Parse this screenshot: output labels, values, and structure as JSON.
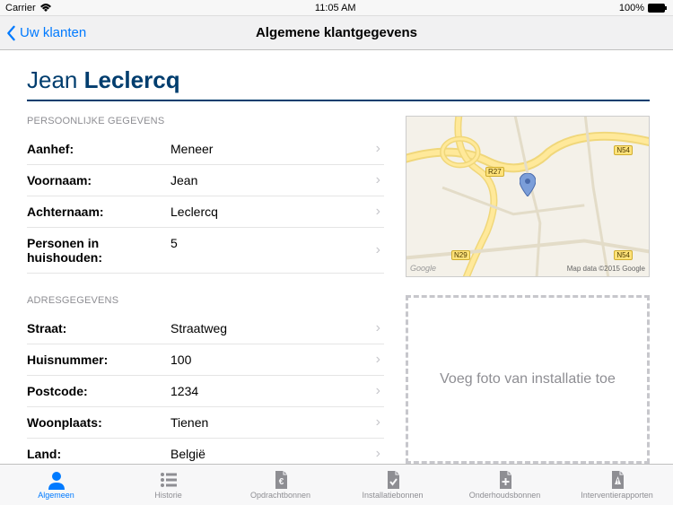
{
  "status": {
    "carrier": "Carrier",
    "time": "11:05 AM",
    "battery": "100%"
  },
  "nav": {
    "back_label": "Uw klanten",
    "title": "Algemene klantgegevens"
  },
  "customer": {
    "first": "Jean",
    "last": "Leclercq"
  },
  "sections": {
    "personal_header": "PERSOONLIJKE GEGEVENS",
    "address_header": "ADRESGEGEVENS"
  },
  "rows": {
    "aanhef": {
      "label": "Aanhef:",
      "value": "Meneer"
    },
    "voornaam": {
      "label": "Voornaam:",
      "value": "Jean"
    },
    "achternaam": {
      "label": "Achternaam:",
      "value": " Leclercq"
    },
    "personen": {
      "label": "Personen in huishouden:",
      "value": "5"
    },
    "straat": {
      "label": "Straat:",
      "value": "Straatweg"
    },
    "huisnummer": {
      "label": "Huisnummer:",
      "value": "100"
    },
    "postcode": {
      "label": "Postcode:",
      "value": "1234"
    },
    "woonplaats": {
      "label": "Woonplaats:",
      "value": "Tienen"
    },
    "land": {
      "label": "Land:",
      "value": "België"
    }
  },
  "map": {
    "logo": "Google",
    "attribution": "Map data ©2015 Google",
    "roads": {
      "n54": "N54",
      "r27": "R27",
      "n29": "N29"
    }
  },
  "photo_placeholder": "Voeg foto van installatie toe",
  "tabs": {
    "algemeen": "Algemeen",
    "historie": "Historie",
    "opdrachtbonnen": "Opdrachtbonnen",
    "installatiebonnen": "Installatiebonnen",
    "onderhoudsbonnen": "Onderhoudsbonnen",
    "interventierapporten": "Interventierapporten"
  }
}
